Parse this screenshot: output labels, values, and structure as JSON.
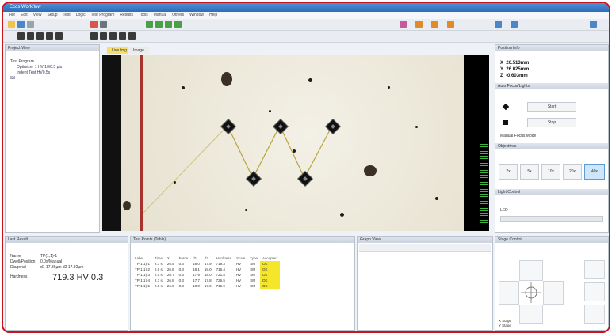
{
  "window": {
    "title": "Ecos Workflow"
  },
  "menu": [
    "File",
    "Edit",
    "View",
    "Setup",
    "Test",
    "Logic",
    "Test Program",
    "Results",
    "Tools",
    "Manual",
    "Others",
    "Window",
    "Help"
  ],
  "tree": {
    "header": "Project View",
    "items": [
      "Test Program",
      "Optimizer 1 HV 10/0.5 pts",
      "Indent Test HV0.5s",
      "Stl"
    ]
  },
  "image_tabs": [
    "Live Img",
    "Image"
  ],
  "position": {
    "header": "Position Info",
    "x": "26.513mm",
    "y": "26.025mm",
    "z": "-0.603mm",
    "x_label": "X",
    "y_label": "Y",
    "z_label": "Z"
  },
  "controls": {
    "header": "Auto Focus/Lights",
    "btn1": "Start",
    "btn2": "Stop",
    "checkbox": "Manual Focus Mode",
    "objectives_header": "Objectives",
    "objectives": [
      "2x",
      "5x",
      "10x",
      "20x",
      "40x"
    ],
    "light_header": "Light Control",
    "light_label": "LED"
  },
  "results_panel": {
    "header": "Last Result",
    "rows": [
      {
        "label": "Name",
        "value": "TP(1,1)-1"
      },
      {
        "label": "Dwell/Position",
        "value": "0.0s/Manual"
      },
      {
        "label": "Diagonal",
        "value": "d1 17.86µm  d2 17.92µm"
      }
    ],
    "result_label": "Hardness",
    "result_value": "719.3 HV 0.3"
  },
  "table": {
    "header": "Test Points (Table)",
    "columns": [
      "Label",
      "Time",
      "X",
      "Force",
      "d1",
      "d2",
      "Hardness",
      "Scale",
      "Type",
      "Accepted"
    ],
    "rows": [
      [
        "TP(1,1)-1",
        "2.1 s",
        "26.5",
        "0.3",
        "18.0",
        "17.9",
        "719.3",
        "HV",
        "SM",
        "OK"
      ],
      [
        "TP(1,1)-2",
        "2.0 s",
        "26.6",
        "0.3",
        "18.1",
        "18.0",
        "716.4",
        "HV",
        "SM",
        "OK"
      ],
      [
        "TP(1,1)-3",
        "2.0 s",
        "26.7",
        "0.3",
        "17.9",
        "18.0",
        "721.8",
        "HV",
        "SM",
        "OK"
      ],
      [
        "TP(1,1)-4",
        "2.1 s",
        "26.8",
        "0.3",
        "17.7",
        "17.8",
        "726.5",
        "HV",
        "SM",
        "OK"
      ],
      [
        "TP(1,1)-5",
        "2.0 s",
        "26.9",
        "0.3",
        "18.0",
        "17.9",
        "719.9",
        "HV",
        "SM",
        "OK"
      ]
    ]
  },
  "graph_panel": {
    "header": "Graph View"
  },
  "nav_panel": {
    "header": "Stage Control",
    "footer1": "X Stage",
    "footer2": "Y Stage"
  },
  "colors": {
    "accent": "#2d6db8",
    "highlight": "#f5e62a",
    "frame": "#c8141e"
  }
}
